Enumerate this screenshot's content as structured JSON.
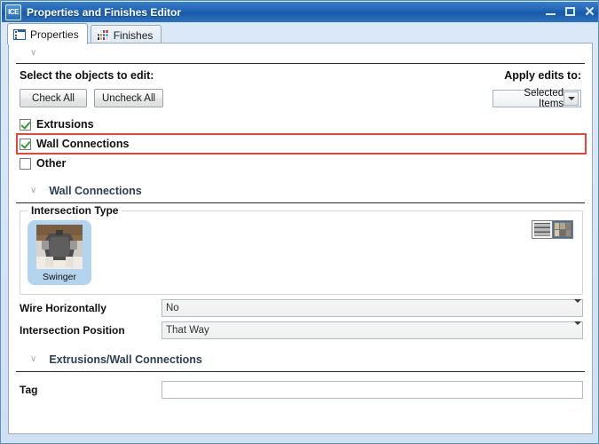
{
  "window": {
    "app_icon_text": "ICE",
    "title": "Properties and Finishes Editor",
    "minimize_label": "Minimize",
    "maximize_label": "Maximize",
    "close_label": "Close"
  },
  "tabs": [
    {
      "label": "Properties",
      "icon": "list-icon",
      "active": true
    },
    {
      "label": "Finishes",
      "icon": "color-swatch-grid-icon",
      "active": false
    }
  ],
  "finishes_icon_colors": [
    "#ffffff",
    "#e8e0b8",
    "#6a4da8",
    "#e04a4a",
    "#3a6fc4",
    "#8fbf3a",
    "#c24ab0",
    "#4ac2c2",
    "#2a2a2a",
    "#e8a83a",
    "#5a3a8a",
    "#d9d9d9"
  ],
  "top_collapse": {
    "chevron": "∨"
  },
  "select_objects": {
    "heading": "Select the objects to edit:",
    "check_all_label": "Check All",
    "uncheck_all_label": "Uncheck All",
    "items": [
      {
        "label": "Extrusions",
        "checked": true,
        "highlighted": false
      },
      {
        "label": "Wall Connections",
        "checked": true,
        "highlighted": true
      },
      {
        "label": "Other",
        "checked": false,
        "highlighted": false
      }
    ]
  },
  "apply_edits": {
    "heading": "Apply edits to:",
    "selected_value": "Selected Items",
    "options": [
      "Selected Items"
    ]
  },
  "wall_connections_section": {
    "chevron": "∨",
    "title": "Wall Connections",
    "intersection_type": {
      "legend": "Intersection Type",
      "items": [
        {
          "label": "Swinger",
          "selected": true
        }
      ],
      "view_toggle": {
        "list_view_label": "List view",
        "grid_view_label": "Thumbnail view",
        "active": "grid"
      },
      "grid_icon_colors": [
        "#cdbb8e",
        "#b2a48a",
        "#8f7f6e",
        "#d7c9a6",
        "#7a6b5c",
        "#9b8b76"
      ]
    },
    "fields": [
      {
        "label": "Wire Horizontally",
        "value": "No",
        "type": "dropdown"
      },
      {
        "label": "Intersection Position",
        "value": "That Way",
        "type": "dropdown"
      }
    ]
  },
  "extrusions_wall_section": {
    "chevron": "∨",
    "title": "Extrusions/Wall Connections",
    "fields": [
      {
        "label": "Tag",
        "value": "",
        "placeholder": "",
        "type": "text"
      }
    ]
  },
  "colors": {
    "title_bar": "#1f63b4",
    "highlight_red": "#e8453c",
    "selection_blue": "#b3d4ef",
    "check_green": "#2e9e2e"
  }
}
